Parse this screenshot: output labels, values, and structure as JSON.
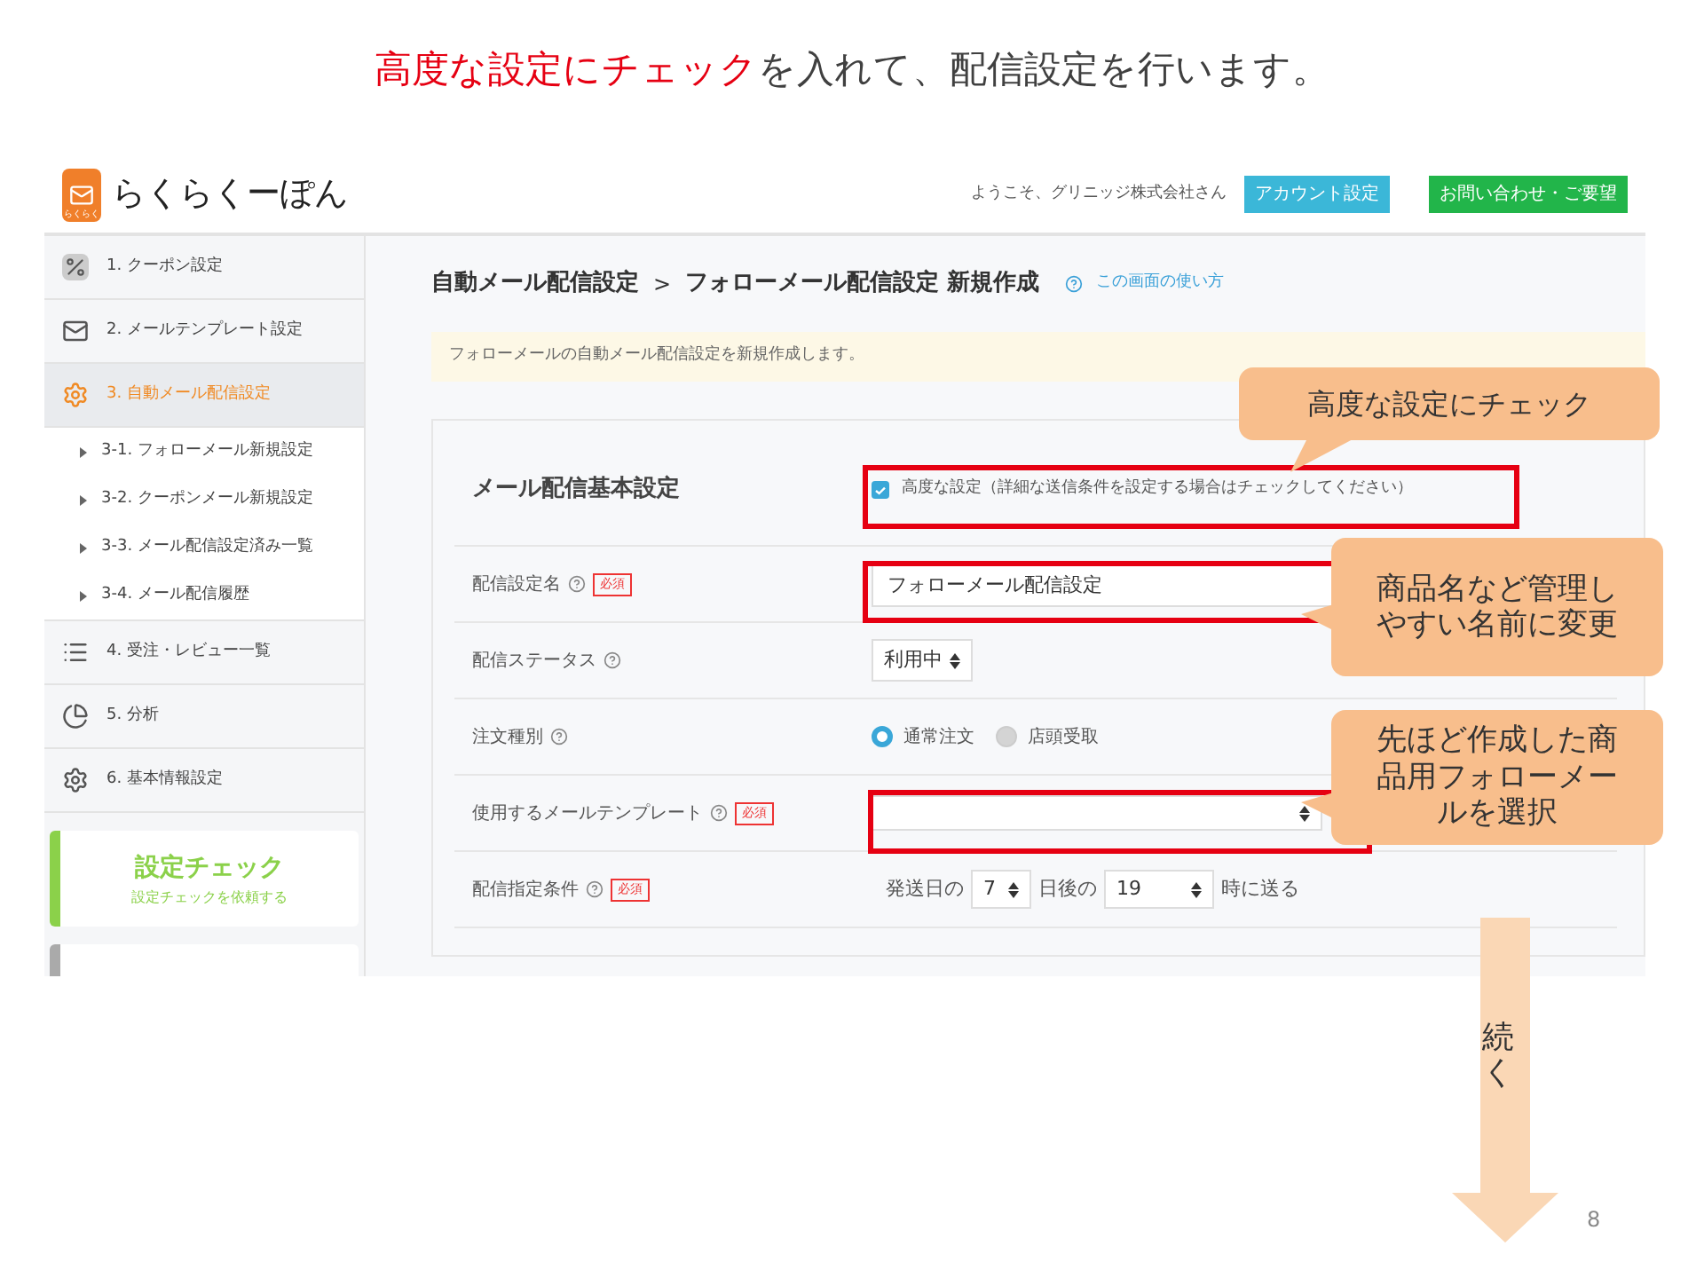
{
  "slide": {
    "title": {
      "highlight": "高度な設定にチェック",
      "rest": "を入れて、配信設定を行います。"
    },
    "page_number": "8",
    "arrow_label": "続く"
  },
  "header": {
    "logo_badge": "らくらく",
    "logo_name": "らくらくーぽん",
    "welcome": "ようこそ、グリニッジ株式会社さん",
    "buttons": [
      {
        "label": "アカウント設定",
        "kind": "account"
      },
      {
        "label": "お問い合わせ・ご要望",
        "kind": "contact"
      }
    ]
  },
  "sidebar": {
    "items": [
      {
        "label": "1. クーポン設定",
        "kind": "coupon",
        "selected": false
      },
      {
        "label": "2. メールテンプレート設定",
        "kind": "mail",
        "selected": false
      },
      {
        "label": "3. 自動メール配信設定",
        "kind": "automail",
        "selected": true,
        "children": [
          {
            "label": "3-1. フォローメール新規設定"
          },
          {
            "label": "3-2. クーポンメール新規設定"
          },
          {
            "label": "3-3. メール配信設定済み一覧"
          },
          {
            "label": "3-4. メール配信履歴"
          }
        ]
      },
      {
        "label": "4. 受注・レビュー一覧",
        "kind": "list",
        "selected": false
      },
      {
        "label": "5. 分析",
        "kind": "chart",
        "selected": false
      },
      {
        "label": "6. 基本情報設定",
        "kind": "gear",
        "selected": false
      }
    ],
    "cards": [
      {
        "title": "設定チェック",
        "subtitle": "設定チェックを依頼する",
        "color": "#8bd14a"
      },
      {
        "color": "#aaaaaa"
      }
    ]
  },
  "main": {
    "breadcrumb": {
      "parent": "自動メール配信設定",
      "separator": ">",
      "current": "フォローメール配信設定 新規作成"
    },
    "help_link": "この画面の使い方",
    "notice": "フォローメールの自動メール配信設定を新規作成します。",
    "form": {
      "heading": "メール配信基本設定",
      "advanced": {
        "label": "高度な設定（詳細な送信条件を設定する場合はチェックしてください）",
        "checked": true
      },
      "rows": [
        {
          "label": "配信設定名",
          "badge": "必須",
          "kind": "text",
          "value": "フォローメール配信設定"
        },
        {
          "label": "配信ステータス",
          "kind": "select",
          "value": "利用中"
        },
        {
          "label": "注文種別",
          "kind": "radio",
          "options": [
            {
              "label": "通常注文",
              "selected": true
            },
            {
              "label": "店頭受取",
              "selected": false
            }
          ]
        },
        {
          "label": "使用するメールテンプレート",
          "badge": "必須",
          "kind": "wide_select"
        },
        {
          "label": "配信指定条件",
          "badge": "必須",
          "kind": "schedule",
          "prefix": "発送日の",
          "day": "7",
          "middle": "日後の",
          "hour": "19",
          "suffix": "時に送る"
        }
      ]
    }
  },
  "callouts": [
    {
      "text": "高度な設定にチェック",
      "kind": "down"
    },
    {
      "text": "商品名など管理しやすい名前に変更",
      "kind": "left"
    },
    {
      "text": "先ほど作成した商品用フォローメールを選択",
      "kind": "left"
    }
  ]
}
